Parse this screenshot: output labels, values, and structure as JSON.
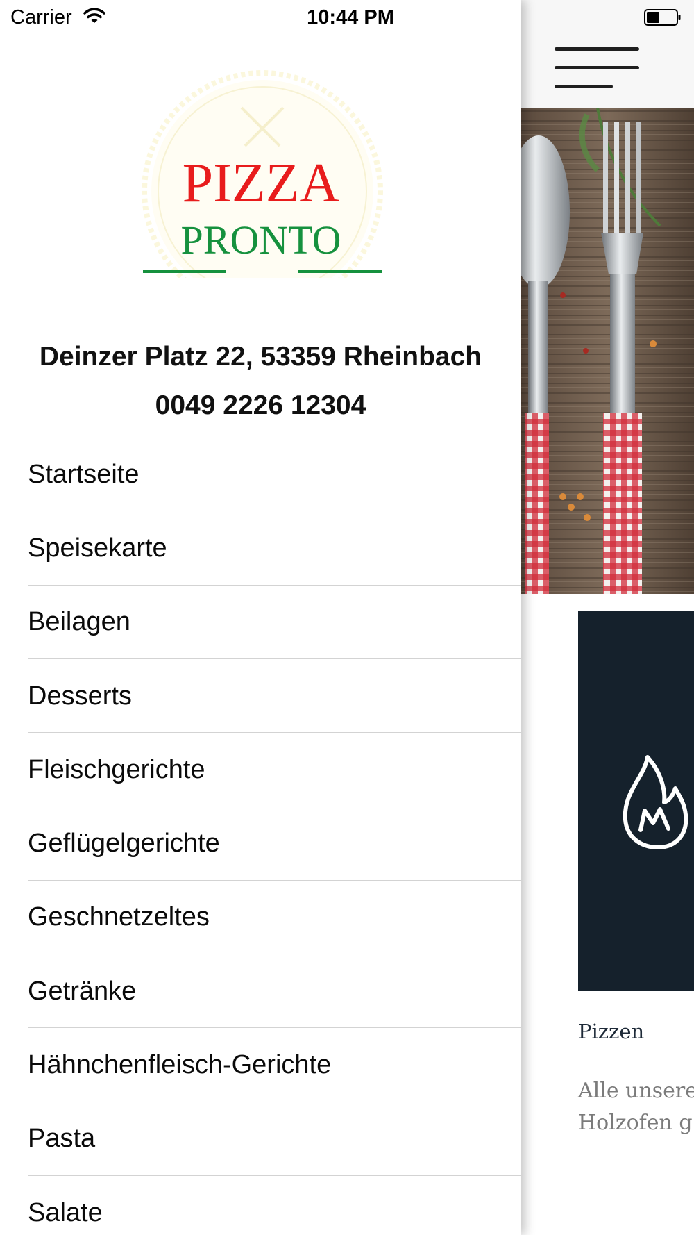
{
  "status_bar": {
    "carrier": "Carrier",
    "time": "10:44 PM",
    "wifi_icon": "wifi-icon",
    "battery_icon": "battery-icon"
  },
  "drawer": {
    "logo": {
      "line1": "PIZZA",
      "line2": "PRONTO",
      "line1_color": "#e81c1c",
      "line2_color": "#16913e"
    },
    "address": "Deinzer Platz 22, 53359 Rheinbach",
    "phone": "0049 2226 12304",
    "menu_items": [
      {
        "label": "Startseite"
      },
      {
        "label": "Speisekarte"
      },
      {
        "label": "Beilagen"
      },
      {
        "label": "Desserts"
      },
      {
        "label": "Fleischgerichte"
      },
      {
        "label": "Geflügelgerichte"
      },
      {
        "label": "Geschnetzeltes"
      },
      {
        "label": "Getränke"
      },
      {
        "label": "Hähnchenfleisch-Gerichte"
      },
      {
        "label": "Pasta"
      },
      {
        "label": "Salate"
      }
    ]
  },
  "main": {
    "menu_icon": "hamburger-icon",
    "feature": {
      "icon": "flame-icon",
      "title": "Pizzen",
      "text_line1": "Alle unsere",
      "text_line2": "Holzofen g"
    },
    "colors": {
      "card_background": "#15212c",
      "header_background": "#f7f7f7"
    }
  }
}
